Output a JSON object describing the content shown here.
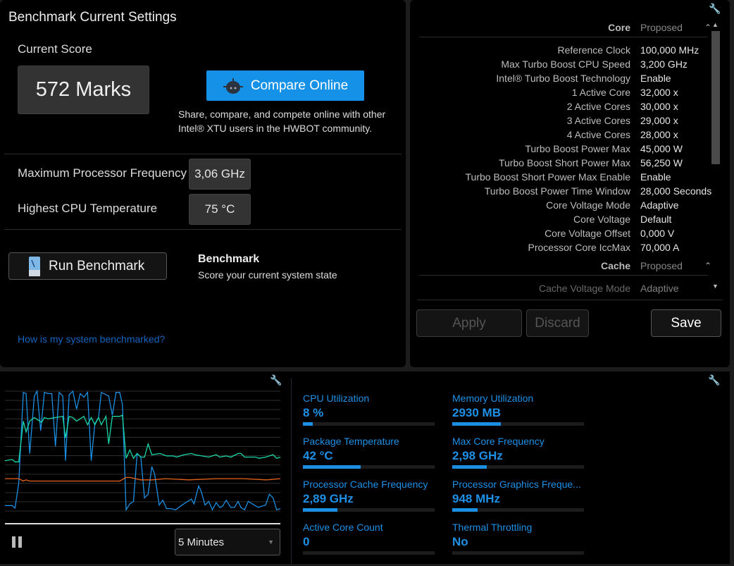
{
  "left": {
    "title": "Benchmark Current Settings",
    "current_score_label": "Current Score",
    "score": "572 Marks",
    "compare_button": "Compare Online",
    "compare_desc_line1": "Share, compare, and compete online with other",
    "compare_desc_line2": "Intel® XTU users in the HWBOT community.",
    "max_freq_label": "Maximum Processor Frequency",
    "max_freq_value": "3,06 GHz",
    "max_temp_label": "Highest CPU Temperature",
    "max_temp_value": "75 °C",
    "run_button": "Run Benchmark",
    "bench_title": "Benchmark",
    "bench_desc": "Score your current system state",
    "help_link": "How is my system benchmarked?"
  },
  "right": {
    "core_header": "Core",
    "proposed": "Proposed",
    "core_rows": [
      {
        "k": "Reference Clock",
        "v": "100,000 MHz"
      },
      {
        "k": "Max Turbo Boost CPU Speed",
        "v": "3,200 GHz"
      },
      {
        "k": "Intel® Turbo Boost Technology",
        "v": "Enable"
      },
      {
        "k": "1 Active Core",
        "v": "32,000 x"
      },
      {
        "k": "2 Active Cores",
        "v": "30,000 x"
      },
      {
        "k": "3 Active Cores",
        "v": "29,000 x"
      },
      {
        "k": "4 Active Cores",
        "v": "28,000 x"
      },
      {
        "k": "Turbo Boost Power Max",
        "v": "45,000 W"
      },
      {
        "k": "Turbo Boost Short Power Max",
        "v": "56,250 W"
      },
      {
        "k": "Turbo Boost Short Power Max Enable",
        "v": "Enable"
      },
      {
        "k": "Turbo Boost Power Time Window",
        "v": "28,000 Seconds"
      },
      {
        "k": "Core Voltage Mode",
        "v": "Adaptive"
      },
      {
        "k": "Core Voltage",
        "v": "Default"
      },
      {
        "k": "Core Voltage Offset",
        "v": "0,000 V"
      },
      {
        "k": "Processor Core IccMax",
        "v": "70,000 A"
      }
    ],
    "cache_header": "Cache",
    "cache_rows": [
      {
        "k": "Cache Voltage Mode",
        "v": "Adaptive"
      }
    ],
    "apply": "Apply",
    "discard": "Discard",
    "save": "Save"
  },
  "monitor": {
    "timespan": "5 Minutes",
    "metrics": [
      {
        "label": "CPU Utilization",
        "value": "8 %",
        "fill": 0.075
      },
      {
        "label": "Memory Utilization",
        "value": "2930  MB",
        "fill": 0.37
      },
      {
        "label": "Package Temperature",
        "value": "42 °C",
        "fill": 0.44
      },
      {
        "label": "Max Core Frequency",
        "value": "2,98 GHz",
        "fill": 0.26
      },
      {
        "label": "Processor Cache Frequency",
        "value": "2,89 GHz",
        "fill": 0.26
      },
      {
        "label": "Processor Graphics Freque...",
        "value": "948 MHz",
        "fill": 0.19
      },
      {
        "label": "Active Core Count",
        "value": "0",
        "fill": 0
      },
      {
        "label": "Thermal Throttling",
        "value": "No",
        "fill": 0
      }
    ]
  },
  "chart_data": {
    "type": "line",
    "xlim": [
      0,
      300
    ],
    "ylim": [
      0,
      100
    ],
    "grid": true,
    "series": [
      {
        "name": "cpu-utilization",
        "color": "#1a8fe3",
        "points": [
          [
            0,
            4.5
          ],
          [
            8,
            4.5
          ],
          [
            11,
            2.5
          ],
          [
            15,
            23
          ],
          [
            20,
            99
          ],
          [
            23,
            98
          ],
          [
            27,
            48
          ],
          [
            32,
            96
          ],
          [
            35,
            100
          ],
          [
            39,
            67
          ],
          [
            43,
            99
          ],
          [
            47,
            98
          ],
          [
            51,
            98
          ],
          [
            55,
            54
          ],
          [
            59,
            99
          ],
          [
            63,
            96
          ],
          [
            66,
            42
          ],
          [
            70,
            97
          ],
          [
            74,
            100
          ],
          [
            78,
            85
          ],
          [
            82,
            98
          ],
          [
            86,
            95
          ],
          [
            90,
            99
          ],
          [
            94,
            42
          ],
          [
            98,
            73
          ],
          [
            102,
            78
          ],
          [
            105,
            99
          ],
          [
            113,
            96
          ],
          [
            117,
            80
          ],
          [
            121,
            99
          ],
          [
            125,
            99
          ],
          [
            128,
            89
          ],
          [
            132,
            1
          ],
          [
            136,
            6
          ],
          [
            140,
            8
          ],
          [
            144,
            48
          ],
          [
            148,
            45
          ],
          [
            152,
            11
          ],
          [
            156,
            14
          ],
          [
            160,
            37
          ],
          [
            163,
            31
          ],
          [
            168,
            5
          ],
          [
            172,
            9
          ],
          [
            176,
            2
          ],
          [
            181,
            2
          ],
          [
            186,
            1
          ],
          [
            191,
            4
          ],
          [
            203,
            10
          ],
          [
            206,
            6
          ],
          [
            211,
            21
          ],
          [
            214,
            16
          ],
          [
            218,
            5
          ],
          [
            222,
            8
          ],
          [
            226,
            1
          ],
          [
            230,
            7
          ],
          [
            234,
            3
          ],
          [
            237,
            4
          ],
          [
            241,
            9
          ],
          [
            246,
            3
          ],
          [
            250,
            3
          ],
          [
            254,
            8
          ],
          [
            257,
            3
          ],
          [
            261,
            1
          ],
          [
            265,
            8
          ],
          [
            276,
            3
          ],
          [
            284,
            5
          ],
          [
            288,
            14
          ],
          [
            292,
            11
          ],
          [
            296,
            1
          ],
          [
            300,
            2
          ]
        ]
      },
      {
        "name": "package-temperature",
        "color": "#1ad6a8",
        "points": [
          [
            0,
            42
          ],
          [
            8,
            43
          ],
          [
            11,
            41
          ],
          [
            15,
            41
          ],
          [
            20,
            75
          ],
          [
            23,
            66
          ],
          [
            27,
            75
          ],
          [
            32,
            78
          ],
          [
            40,
            74
          ],
          [
            43,
            78
          ],
          [
            47,
            77
          ],
          [
            55,
            78
          ],
          [
            63,
            79
          ],
          [
            66,
            61
          ],
          [
            70,
            79
          ],
          [
            74,
            78
          ],
          [
            78,
            75
          ],
          [
            86,
            79
          ],
          [
            90,
            72
          ],
          [
            94,
            78
          ],
          [
            98,
            72
          ],
          [
            102,
            78
          ],
          [
            105,
            72
          ],
          [
            110,
            79
          ],
          [
            113,
            56
          ],
          [
            117,
            79
          ],
          [
            125,
            79
          ],
          [
            128,
            80
          ],
          [
            132,
            44
          ],
          [
            136,
            51
          ],
          [
            140,
            44
          ],
          [
            144,
            48
          ],
          [
            148,
            45
          ],
          [
            152,
            45
          ],
          [
            156,
            56
          ],
          [
            160,
            47
          ],
          [
            169,
            48
          ],
          [
            176,
            46
          ],
          [
            183,
            46
          ],
          [
            187,
            45
          ],
          [
            195,
            47
          ],
          [
            203,
            48
          ],
          [
            207,
            47
          ],
          [
            222,
            45
          ],
          [
            230,
            47
          ],
          [
            234,
            45
          ],
          [
            241,
            46
          ],
          [
            246,
            45
          ],
          [
            254,
            48
          ],
          [
            257,
            48
          ],
          [
            261,
            45
          ],
          [
            273,
            45
          ],
          [
            277,
            44
          ],
          [
            284,
            45
          ],
          [
            292,
            47
          ],
          [
            296,
            44
          ],
          [
            300,
            45
          ]
        ]
      },
      {
        "name": "power",
        "color": "#e8641a",
        "points": [
          [
            0,
            27
          ],
          [
            15,
            27
          ],
          [
            20,
            25
          ],
          [
            23,
            26
          ],
          [
            27,
            25
          ],
          [
            60,
            25
          ],
          [
            66,
            25
          ],
          [
            78,
            25
          ],
          [
            86,
            25
          ],
          [
            94,
            25
          ],
          [
            125,
            25
          ],
          [
            132,
            28
          ],
          [
            136,
            28
          ],
          [
            148,
            26
          ],
          [
            160,
            26
          ],
          [
            175,
            27
          ],
          [
            200,
            26
          ],
          [
            230,
            27
          ],
          [
            260,
            27
          ],
          [
            285,
            26
          ],
          [
            300,
            27
          ]
        ]
      }
    ]
  }
}
